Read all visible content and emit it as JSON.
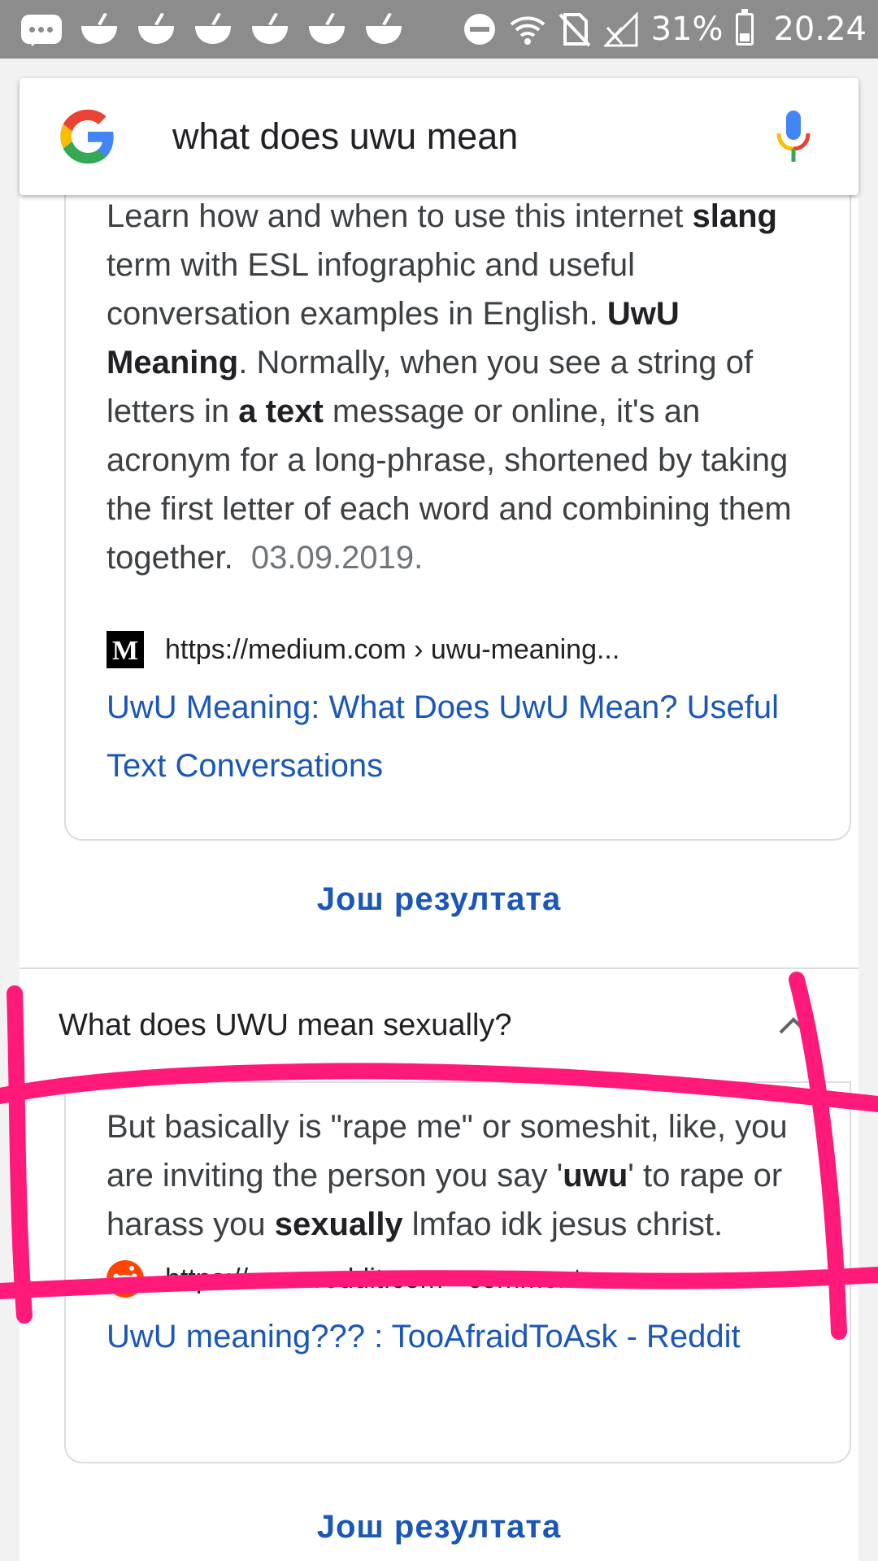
{
  "status_bar": {
    "battery": "31%",
    "time": "20.24"
  },
  "search": {
    "query": "what does uwu mean"
  },
  "result1": {
    "snippet_parts": {
      "p1": "Learn how and when to use this internet ",
      "b1": "slang",
      "p2": " term with ESL infographic and useful conversation examples in English. ",
      "b2": "UwU Meaning",
      "p3": ". Normally, when you see a string of letters in ",
      "b3": "a text",
      "p4": " message or online, it's an acronym for a long-phrase, shortened by taking the first letter of each word and combining them together.",
      "date": "03.09.2019."
    },
    "source_url": "https://medium.com › uwu-meaning...",
    "favicon_letter": "M",
    "title": "UwU Meaning: What Does UwU Mean? Useful Text Conversations"
  },
  "more_results_label": "Још резултата",
  "faq": {
    "question": "What does UWU mean sexually?",
    "answer_parts": {
      "p1": "But basically is \"rape me\" or someshit, like, you are inviting the person you say '",
      "b1": "uwu",
      "p2": "' to rape or harass you ",
      "b2": "sexually",
      "p3": " lmfao idk jesus christ."
    },
    "source_url": "https://www.reddit.com › comments",
    "title": "UwU meaning??? : TooAfraidToAsk - Reddit"
  },
  "colors": {
    "link": "#1a57b8",
    "highlight_marker": "#ff1a7a",
    "status_bar": "#8c8c8c"
  }
}
